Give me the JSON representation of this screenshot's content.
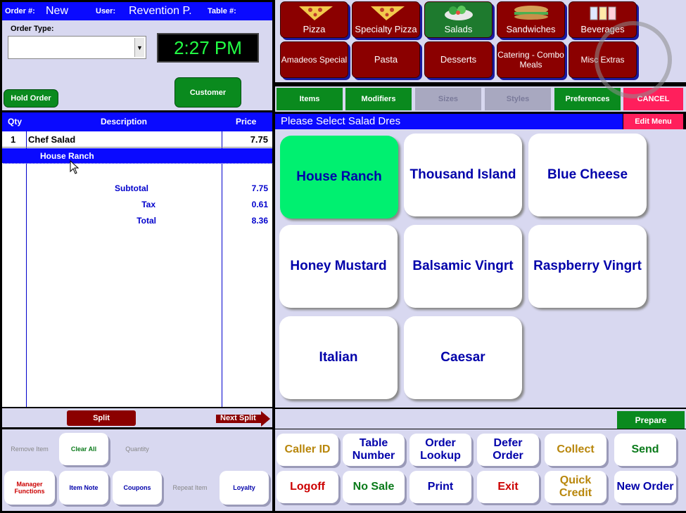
{
  "header": {
    "order_label": "Order #:",
    "order_value": "New",
    "user_label": "User:",
    "user_value": "Revention P.",
    "table_label": "Table #:"
  },
  "order_type": {
    "label": "Order Type:",
    "value": ""
  },
  "clock": "2:27 PM",
  "hold_order": "Hold Order",
  "customer": "Customer",
  "order_table": {
    "columns": [
      "Qty",
      "Description",
      "Price"
    ],
    "rows": [
      {
        "qty": "1",
        "description": "Chef Salad",
        "price": "7.75"
      }
    ],
    "modifier": "House Ranch",
    "subtotal_label": "Subtotal",
    "subtotal": "7.75",
    "tax_label": "Tax",
    "tax": "0.61",
    "total_label": "Total",
    "total": "8.36"
  },
  "split": "Split",
  "next_split": "Next Split",
  "left_buttons": {
    "remove_item": "Remove Item",
    "clear_all": "Clear All",
    "quantity": "Quantity",
    "manager_functions": "Manager Functions",
    "item_note": "Item Note",
    "coupons": "Coupons",
    "repeat_item": "Repeat Item",
    "loyalty": "Loyalty"
  },
  "categories": {
    "pizza": "Pizza",
    "specialty_pizza": "Specialty Pizza",
    "salads": "Salads",
    "sandwiches": "Sandwiches",
    "beverages": "Beverages",
    "amadeos_special": "Amadeos Special",
    "pasta": "Pasta",
    "desserts": "Desserts",
    "catering": "Catering - Combo Meals",
    "misc_extras": "Misc Extras"
  },
  "tabs": {
    "items": "Items",
    "modifiers": "Modifiers",
    "sizes": "Sizes",
    "styles": "Styles",
    "preferences": "Preferences",
    "cancel": "CANCEL"
  },
  "prompt": "Please Select Salad Dres",
  "edit_menu": "Edit Menu",
  "choices": {
    "c1": "House Ranch",
    "c2": "Thousand Island",
    "c3": "Blue Cheese",
    "c4": "Honey Mustard",
    "c5": "Balsamic Vingrt",
    "c6": "Raspberry Vingrt",
    "c7": "Italian",
    "c8": "Caesar"
  },
  "prepare": "Prepare",
  "functions": {
    "caller_id": "Caller ID",
    "table_number": "Table Number",
    "order_lookup": "Order Lookup",
    "defer_order": "Defer Order",
    "collect": "Collect",
    "send": "Send",
    "logoff": "Logoff",
    "no_sale": "No Sale",
    "print": "Print",
    "exit": "Exit",
    "quick_credit": "Quick Credit",
    "new_order": "New Order"
  },
  "colors": {
    "blue": "#0a0aff",
    "green": "#0a8a1e",
    "maroon": "#8b0000",
    "pink": "#ff1f5c",
    "selected": "#00f070"
  }
}
